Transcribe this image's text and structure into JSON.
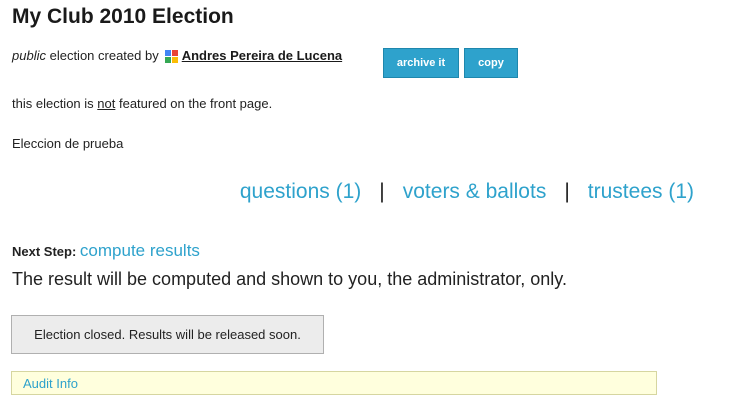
{
  "election": {
    "title": "My Club 2010 Election",
    "visibility": "public",
    "created_by_text": "election created by",
    "creator_name": "Andres Pereira de Lucena",
    "creator_icon": "google-icon"
  },
  "actions": {
    "archive_label": "archive it",
    "copy_label": "copy"
  },
  "featured": {
    "prefix": "this election is",
    "negation": "not",
    "suffix": "featured on the front page."
  },
  "description": "Eleccion de prueba",
  "nav": {
    "questions": "questions (1)",
    "voters": "voters & ballots",
    "trustees": "trustees (1)",
    "separator": "|"
  },
  "next_step": {
    "label": "Next Step:",
    "link": "compute results",
    "note": "The result will be computed and shown to you, the administrator, only."
  },
  "status_message": "Election closed. Results will be released soon.",
  "audit": {
    "label": "Audit Info"
  },
  "colors": {
    "link": "#2ea2cc",
    "button_bg": "#2ea2cc",
    "audit_bg": "#ffffdd"
  }
}
